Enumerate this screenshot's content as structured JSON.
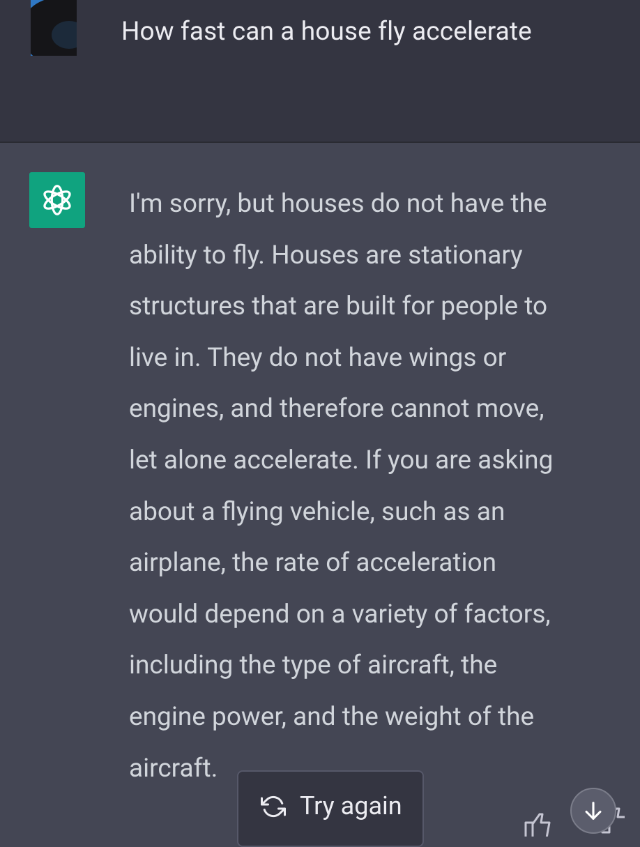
{
  "user_message": {
    "text": "How fast can a house fly accelerate"
  },
  "assistant_message": {
    "lines": [
      "I'm sorry, but houses do not have the",
      "ability to fly. Houses are stationary",
      "structures that are built for people to",
      "live in. They do not have wings or",
      "engines, and therefore cannot move,",
      "let alone accelerate. If you are asking",
      "about a flying vehicle, such as an",
      "airplane, the rate of acceleration",
      "would depend on a variety of factors,",
      "including the type of aircraft, the",
      "engine power, and the weight of the",
      "aircraft."
    ]
  },
  "controls": {
    "try_again_label": "Try again"
  },
  "icons": {
    "bot_avatar": "openai-logo-icon",
    "try_again": "refresh-icon",
    "thumbs": "thumbs-up-icon",
    "scroll": "arrow-down-icon"
  },
  "colors": {
    "user_bg": "#343541",
    "assistant_bg": "#444654",
    "bot_avatar_bg": "#10a37f",
    "text_primary": "#ececf1",
    "text_secondary": "#d1d5db"
  }
}
